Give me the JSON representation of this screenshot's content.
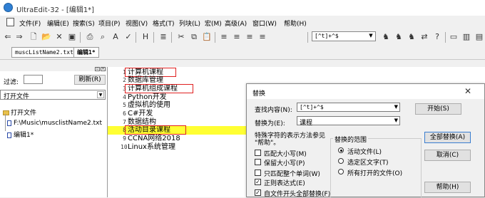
{
  "window": {
    "title": "UltraEdit-32 - [编辑1*]"
  },
  "menu": [
    "文件(F)",
    "编辑(E)",
    "搜索(S)",
    "项目(P)",
    "视图(V)",
    "格式(T)",
    "列块(L)",
    "宏(M)",
    "高级(A)",
    "窗口(W)",
    "帮助(H)"
  ],
  "toolbar": {
    "regex_value": "[^t]+^$"
  },
  "tabs": [
    {
      "label": "muscListName2.txt",
      "active": false
    },
    {
      "label": "编辑1*",
      "active": true
    }
  ],
  "left_panel": {
    "filter_label": "过滤:",
    "refresh_label": "刷新(R)",
    "open_files_select": "打开文件",
    "tree": {
      "root": "打开文件",
      "items": [
        "F:\\Music\\musclistName2.txt",
        "编辑1*"
      ]
    }
  },
  "editor": {
    "highlight_color": "#ffff33",
    "box_color": "#e02020",
    "lines": [
      {
        "n": "1",
        "text": "计算机课程",
        "boxed": true,
        "highlight": false
      },
      {
        "n": "2",
        "text": "数据库管理",
        "boxed": false,
        "highlight": false
      },
      {
        "n": "3",
        "text": "计算机组成课程",
        "boxed": true,
        "highlight": false
      },
      {
        "n": "4",
        "text": "Python开发",
        "boxed": false,
        "highlight": false
      },
      {
        "n": "5",
        "text": "虚拟机的使用",
        "boxed": false,
        "highlight": false
      },
      {
        "n": "6",
        "text": "C#开发",
        "boxed": false,
        "highlight": false
      },
      {
        "n": "7",
        "text": "数据结构",
        "boxed": false,
        "highlight": false
      },
      {
        "n": "8",
        "text": "活动目录课程",
        "boxed": true,
        "highlight": true
      },
      {
        "n": "9",
        "text": "CCNA网络2018",
        "boxed": false,
        "highlight": false
      },
      {
        "n": "10",
        "text": "Linux系统管理",
        "boxed": false,
        "highlight": false
      }
    ]
  },
  "dialog": {
    "title": "替换",
    "find_label": "查找内容(N):",
    "find_value": "[^t]+^$",
    "replace_label": "替换为(E):",
    "replace_value": "课程",
    "special_chars_label": "特殊字符的表示方法参见",
    "special_chars_label2": "\"帮助\"。",
    "scope_label": "替换的范围",
    "options": [
      {
        "label": "匹配大小写(M)",
        "checked": false
      },
      {
        "label": "保留大小写(P)",
        "checked": false
      },
      {
        "label": "只匹配整个单词(W)",
        "checked": false
      },
      {
        "label": "正则表达式(E)",
        "checked": true
      },
      {
        "label": "自文件开头全部替换(F)",
        "checked": true
      }
    ],
    "scope": [
      {
        "label": "活动文件(L)",
        "selected": true
      },
      {
        "label": "选定区文字(T)",
        "selected": false
      },
      {
        "label": "所有打开的文件(O)",
        "selected": false
      }
    ],
    "buttons": {
      "start": "开始(S)",
      "replace_all": "全部替换(A)",
      "cancel": "取消(C)",
      "help": "帮助(H)"
    }
  }
}
